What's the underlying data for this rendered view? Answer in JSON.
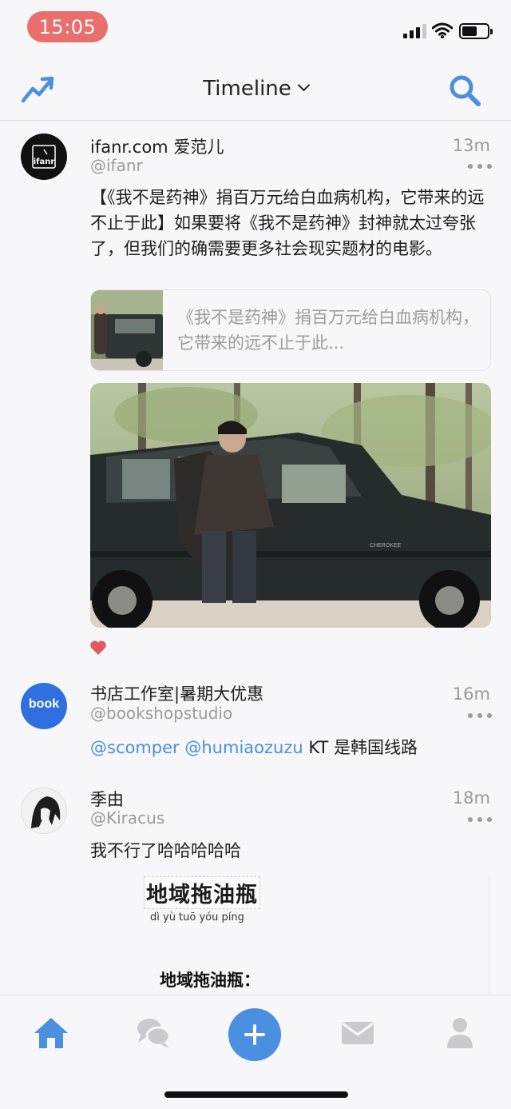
{
  "status_bar": {
    "time": "15:05"
  },
  "nav": {
    "title": "Timeline",
    "left_icon": "trending-icon",
    "right_icon": "search-icon"
  },
  "posts": [
    {
      "name": "ifanr.com 爱范儿",
      "handle": "@ifanr",
      "time": "13m",
      "avatar_label": "ifanr",
      "text": "【《我不是药神》捐百万元给白血病机构，它带来的远不止于此】如果要将《我不是药神》封神就太过夸张了，但我们的确需要更多社会现实题材的电影。",
      "link_card": {
        "title": "《我不是药神》捐百万元给白血病机构，它带来的远不止于此..."
      },
      "liked": true
    },
    {
      "name": "书店工作室|暑期大优惠",
      "handle": "@bookshopstudio",
      "time": "16m",
      "avatar_label": "book",
      "mentions": [
        "@scomper",
        "@humiaozuzu"
      ],
      "text_rest": " KT 是韩国线路"
    },
    {
      "name": "季由",
      "handle": "@Kiracus",
      "time": "18m",
      "text": "我不行了哈哈哈哈哈",
      "image": {
        "title": "地域拖油瓶",
        "pinyin": "dì yù tuō yóu píng",
        "subtitle": "地域拖油瓶："
      }
    }
  ],
  "tabbar": {
    "items": [
      "home-icon",
      "chat-icon",
      "compose-icon",
      "mail-icon",
      "profile-icon"
    ],
    "accent": "#4a8fe0"
  },
  "colors": {
    "accent": "#4a8fe0",
    "time_pill": "#e86f6c",
    "like": "#e05a5a",
    "secondary_text": "#9a9aa0"
  }
}
